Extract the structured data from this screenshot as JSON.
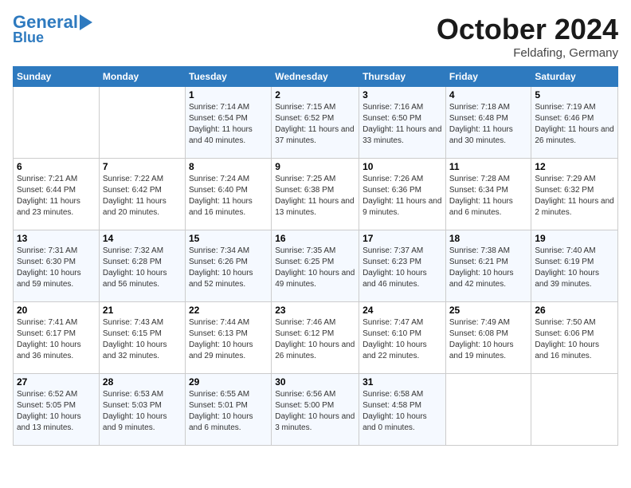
{
  "header": {
    "logo_line1": "General",
    "logo_line2": "Blue",
    "month": "October 2024",
    "location": "Feldafing, Germany"
  },
  "weekdays": [
    "Sunday",
    "Monday",
    "Tuesday",
    "Wednesday",
    "Thursday",
    "Friday",
    "Saturday"
  ],
  "weeks": [
    [
      {
        "day": "",
        "info": ""
      },
      {
        "day": "",
        "info": ""
      },
      {
        "day": "1",
        "info": "Sunrise: 7:14 AM\nSunset: 6:54 PM\nDaylight: 11 hours and 40 minutes."
      },
      {
        "day": "2",
        "info": "Sunrise: 7:15 AM\nSunset: 6:52 PM\nDaylight: 11 hours and 37 minutes."
      },
      {
        "day": "3",
        "info": "Sunrise: 7:16 AM\nSunset: 6:50 PM\nDaylight: 11 hours and 33 minutes."
      },
      {
        "day": "4",
        "info": "Sunrise: 7:18 AM\nSunset: 6:48 PM\nDaylight: 11 hours and 30 minutes."
      },
      {
        "day": "5",
        "info": "Sunrise: 7:19 AM\nSunset: 6:46 PM\nDaylight: 11 hours and 26 minutes."
      }
    ],
    [
      {
        "day": "6",
        "info": "Sunrise: 7:21 AM\nSunset: 6:44 PM\nDaylight: 11 hours and 23 minutes."
      },
      {
        "day": "7",
        "info": "Sunrise: 7:22 AM\nSunset: 6:42 PM\nDaylight: 11 hours and 20 minutes."
      },
      {
        "day": "8",
        "info": "Sunrise: 7:24 AM\nSunset: 6:40 PM\nDaylight: 11 hours and 16 minutes."
      },
      {
        "day": "9",
        "info": "Sunrise: 7:25 AM\nSunset: 6:38 PM\nDaylight: 11 hours and 13 minutes."
      },
      {
        "day": "10",
        "info": "Sunrise: 7:26 AM\nSunset: 6:36 PM\nDaylight: 11 hours and 9 minutes."
      },
      {
        "day": "11",
        "info": "Sunrise: 7:28 AM\nSunset: 6:34 PM\nDaylight: 11 hours and 6 minutes."
      },
      {
        "day": "12",
        "info": "Sunrise: 7:29 AM\nSunset: 6:32 PM\nDaylight: 11 hours and 2 minutes."
      }
    ],
    [
      {
        "day": "13",
        "info": "Sunrise: 7:31 AM\nSunset: 6:30 PM\nDaylight: 10 hours and 59 minutes."
      },
      {
        "day": "14",
        "info": "Sunrise: 7:32 AM\nSunset: 6:28 PM\nDaylight: 10 hours and 56 minutes."
      },
      {
        "day": "15",
        "info": "Sunrise: 7:34 AM\nSunset: 6:26 PM\nDaylight: 10 hours and 52 minutes."
      },
      {
        "day": "16",
        "info": "Sunrise: 7:35 AM\nSunset: 6:25 PM\nDaylight: 10 hours and 49 minutes."
      },
      {
        "day": "17",
        "info": "Sunrise: 7:37 AM\nSunset: 6:23 PM\nDaylight: 10 hours and 46 minutes."
      },
      {
        "day": "18",
        "info": "Sunrise: 7:38 AM\nSunset: 6:21 PM\nDaylight: 10 hours and 42 minutes."
      },
      {
        "day": "19",
        "info": "Sunrise: 7:40 AM\nSunset: 6:19 PM\nDaylight: 10 hours and 39 minutes."
      }
    ],
    [
      {
        "day": "20",
        "info": "Sunrise: 7:41 AM\nSunset: 6:17 PM\nDaylight: 10 hours and 36 minutes."
      },
      {
        "day": "21",
        "info": "Sunrise: 7:43 AM\nSunset: 6:15 PM\nDaylight: 10 hours and 32 minutes."
      },
      {
        "day": "22",
        "info": "Sunrise: 7:44 AM\nSunset: 6:13 PM\nDaylight: 10 hours and 29 minutes."
      },
      {
        "day": "23",
        "info": "Sunrise: 7:46 AM\nSunset: 6:12 PM\nDaylight: 10 hours and 26 minutes."
      },
      {
        "day": "24",
        "info": "Sunrise: 7:47 AM\nSunset: 6:10 PM\nDaylight: 10 hours and 22 minutes."
      },
      {
        "day": "25",
        "info": "Sunrise: 7:49 AM\nSunset: 6:08 PM\nDaylight: 10 hours and 19 minutes."
      },
      {
        "day": "26",
        "info": "Sunrise: 7:50 AM\nSunset: 6:06 PM\nDaylight: 10 hours and 16 minutes."
      }
    ],
    [
      {
        "day": "27",
        "info": "Sunrise: 6:52 AM\nSunset: 5:05 PM\nDaylight: 10 hours and 13 minutes."
      },
      {
        "day": "28",
        "info": "Sunrise: 6:53 AM\nSunset: 5:03 PM\nDaylight: 10 hours and 9 minutes."
      },
      {
        "day": "29",
        "info": "Sunrise: 6:55 AM\nSunset: 5:01 PM\nDaylight: 10 hours and 6 minutes."
      },
      {
        "day": "30",
        "info": "Sunrise: 6:56 AM\nSunset: 5:00 PM\nDaylight: 10 hours and 3 minutes."
      },
      {
        "day": "31",
        "info": "Sunrise: 6:58 AM\nSunset: 4:58 PM\nDaylight: 10 hours and 0 minutes."
      },
      {
        "day": "",
        "info": ""
      },
      {
        "day": "",
        "info": ""
      }
    ]
  ]
}
